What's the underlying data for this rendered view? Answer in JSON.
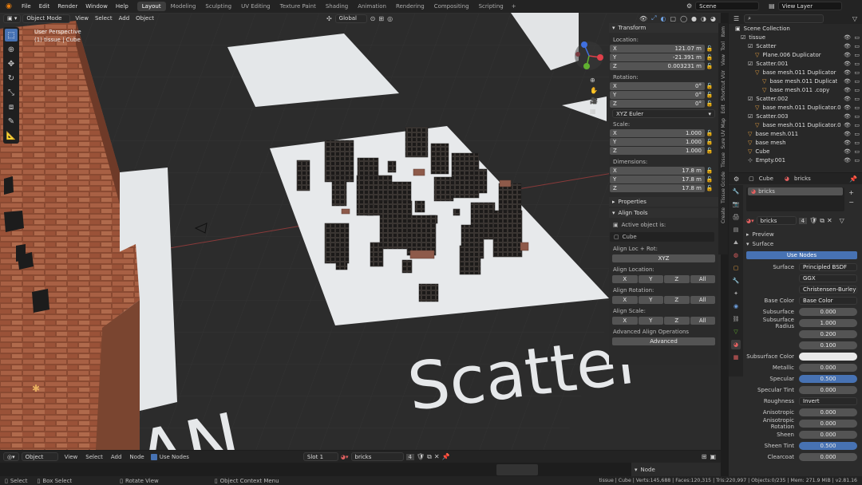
{
  "menubar": {
    "items": [
      "File",
      "Edit",
      "Render",
      "Window",
      "Help"
    ],
    "workspaces": [
      "Layout",
      "Modeling",
      "Sculpting",
      "UV Editing",
      "Texture Paint",
      "Shading",
      "Animation",
      "Rendering",
      "Compositing",
      "Scripting"
    ],
    "active_workspace": "Layout",
    "add_workspace": "+",
    "scene": "Scene",
    "view_layer": "View Layer"
  },
  "viewport": {
    "mode": "Object Mode",
    "menus": [
      "View",
      "Select",
      "Add",
      "Object"
    ],
    "transform_orientation": "Global",
    "view_name": "User Perspective",
    "collection_info": "(1) tissue | Cube",
    "scene_text": "Scatter",
    "scene_text2": "AN"
  },
  "npanel": {
    "tabs": [
      "Item",
      "Tool",
      "View",
      "Shortcut VUr",
      "Edit",
      "Sure UV Map",
      "Tissue",
      "Tissue Gcode",
      "Create"
    ],
    "transform_header": "Transform",
    "location_label": "Location:",
    "location": [
      {
        "axis": "X",
        "value": "121.07 m"
      },
      {
        "axis": "Y",
        "value": "-21.391 m"
      },
      {
        "axis": "Z",
        "value": "0.003231 m"
      }
    ],
    "rotation_label": "Rotation:",
    "rotation": [
      {
        "axis": "X",
        "value": "0°"
      },
      {
        "axis": "Y",
        "value": "0°"
      },
      {
        "axis": "Z",
        "value": "0°"
      }
    ],
    "rotation_mode": "XYZ Euler",
    "scale_label": "Scale:",
    "scale": [
      {
        "axis": "X",
        "value": "1.000"
      },
      {
        "axis": "Y",
        "value": "1.000"
      },
      {
        "axis": "Z",
        "value": "1.000"
      }
    ],
    "dimensions_label": "Dimensions:",
    "dimensions": [
      {
        "axis": "X",
        "value": "17.8 m"
      },
      {
        "axis": "Y",
        "value": "17.8 m"
      },
      {
        "axis": "Z",
        "value": "17.8 m"
      }
    ],
    "properties_header": "Properties",
    "align_header": "Align Tools",
    "active_object_label": "Active object is:",
    "active_object": "Cube",
    "align_loc_rot": "Align Loc + Rot:",
    "xyz_button": "XYZ",
    "align_location": "Align Location:",
    "align_rotation": "Align Rotation:",
    "align_scale": "Align Scale:",
    "axis_buttons": [
      "X",
      "Y",
      "Z",
      "All"
    ],
    "advanced_ops": "Advanced Align Operations",
    "advanced_button": "Advanced"
  },
  "outliner": {
    "header": "Scene Collection",
    "rows": [
      {
        "label": "tissue",
        "indent": 1,
        "icon": "☑"
      },
      {
        "label": "Scatter",
        "indent": 2,
        "icon": "☑"
      },
      {
        "label": "Plane.006 Duplicator",
        "indent": 3,
        "icon": "▽"
      },
      {
        "label": "Scatter.001",
        "indent": 2,
        "icon": "☑"
      },
      {
        "label": "base mesh.011 Duplicator",
        "indent": 3,
        "icon": "▽"
      },
      {
        "label": "base mesh.011 Duplicat",
        "indent": 4,
        "icon": "▽"
      },
      {
        "label": "base mesh.011 .copy",
        "indent": 4,
        "icon": "▽"
      },
      {
        "label": "Scatter.002",
        "indent": 2,
        "icon": "☑"
      },
      {
        "label": "base mesh.011 Duplicator.0",
        "indent": 3,
        "icon": "▽"
      },
      {
        "label": "Scatter.003",
        "indent": 2,
        "icon": "☑"
      },
      {
        "label": "base mesh.011 Duplicator.0",
        "indent": 3,
        "icon": "▽"
      },
      {
        "label": "base mesh.011",
        "indent": 2,
        "icon": "▽"
      },
      {
        "label": "base mesh",
        "indent": 2,
        "icon": "▽"
      },
      {
        "label": "Cube",
        "indent": 2,
        "icon": "▽"
      },
      {
        "label": "Empty.001",
        "indent": 2,
        "icon": "⊹"
      }
    ]
  },
  "properties": {
    "object_name": "Cube",
    "material_name": "bricks",
    "slot_item": "bricks",
    "material_field": "bricks",
    "user_count": "4",
    "preview_header": "Preview",
    "surface_header": "Surface",
    "use_nodes": "Use Nodes",
    "rows": [
      {
        "label": "Surface",
        "value": "Principled BSDF",
        "kind": "menu"
      },
      {
        "label": "",
        "value": "GGX",
        "kind": "menu"
      },
      {
        "label": "",
        "value": "Christensen-Burley",
        "kind": "menu"
      },
      {
        "label": "Base Color",
        "value": "Base Color",
        "kind": "menu"
      },
      {
        "label": "Subsurface",
        "value": "0.000",
        "kind": "num"
      },
      {
        "label": "Subsurface Radius",
        "value": "1.000",
        "kind": "num"
      },
      {
        "label": "",
        "value": "0.200",
        "kind": "num"
      },
      {
        "label": "",
        "value": "0.100",
        "kind": "num"
      },
      {
        "label": "Subsurface Color",
        "value": "",
        "kind": "white"
      },
      {
        "label": "Metallic",
        "value": "0.000",
        "kind": "num"
      },
      {
        "label": "Specular",
        "value": "0.500",
        "kind": "blue"
      },
      {
        "label": "Specular Tint",
        "value": "0.000",
        "kind": "num"
      },
      {
        "label": "Roughness",
        "value": "Invert",
        "kind": "menu"
      },
      {
        "label": "Anisotropic",
        "value": "0.000",
        "kind": "num"
      },
      {
        "label": "Anisotropic Rotation",
        "value": "0.000",
        "kind": "num"
      },
      {
        "label": "Sheen",
        "value": "0.000",
        "kind": "num"
      },
      {
        "label": "Sheen Tint",
        "value": "0.500",
        "kind": "blue"
      },
      {
        "label": "Clearcoat",
        "value": "0.000",
        "kind": "num"
      }
    ]
  },
  "node_editor": {
    "mode": "Object",
    "menus": [
      "View",
      "Select",
      "Add",
      "Node"
    ],
    "use_nodes": "Use Nodes",
    "slot": "Slot 1",
    "material": "bricks",
    "users": "4",
    "node_panel": "Node"
  },
  "statusbar": {
    "select": "Select",
    "box_select": "Box Select",
    "rotate_view": "Rotate View",
    "context_menu": "Object Context Menu",
    "stats": "tissue | Cube | Verts:145,688 | Faces:120,315 | Tris:220,997 | Objects:0/235 | Mem: 271.9 MiB | v2.81.16"
  }
}
